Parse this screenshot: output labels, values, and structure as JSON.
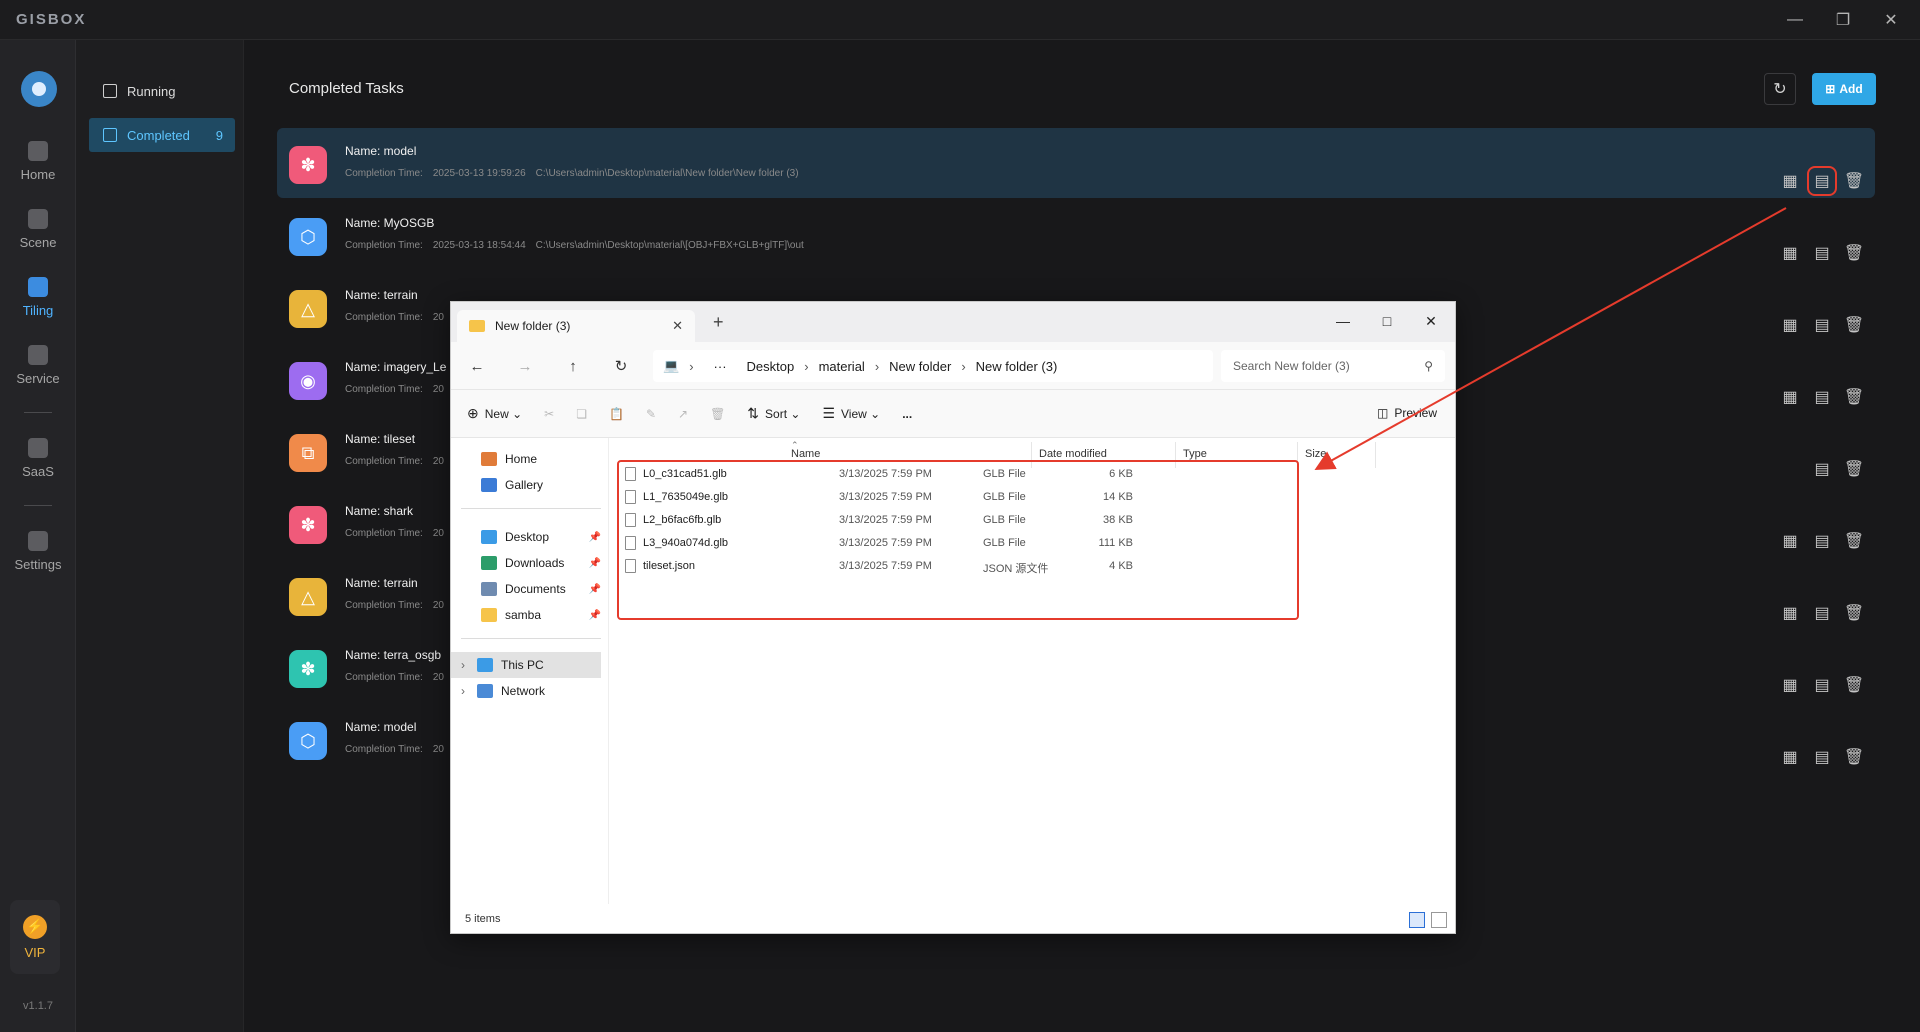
{
  "app": {
    "logo": "GISBOX",
    "version": "v1.1.7"
  },
  "nav": [
    {
      "label": "Home"
    },
    {
      "label": "Scene"
    },
    {
      "label": "Tiling"
    },
    {
      "label": "Service"
    },
    {
      "label": "SaaS"
    },
    {
      "label": "Settings"
    }
  ],
  "vip": {
    "label": "VIP"
  },
  "subnav": {
    "running": "Running",
    "completed": "Completed",
    "completed_count": "9"
  },
  "main": {
    "title": "Completed Tasks",
    "add_label": "Add"
  },
  "tasks": [
    {
      "name": "Name:  model",
      "time_label": "Completion Time:",
      "time": "2025-03-13 19:59:26",
      "path": "C:\\Users\\admin\\Desktop\\material\\New folder\\New folder (3)",
      "color": "#f05a7a"
    },
    {
      "name": "Name:  MyOSGB",
      "time_label": "Completion Time:",
      "time": "2025-03-13 18:54:44",
      "path": "C:\\Users\\admin\\Desktop\\material\\[OBJ+FBX+GLB+glTF]\\out",
      "color": "#4a9df5"
    },
    {
      "name": "Name:  terrain",
      "time_label": "Completion Time:",
      "time": "20",
      "path": "",
      "color": "#e8b43a"
    },
    {
      "name": "Name:  imagery_Le",
      "time_label": "Completion Time:",
      "time": "20",
      "path": "",
      "color": "#9d6cf0"
    },
    {
      "name": "Name:  tileset",
      "time_label": "Completion Time:",
      "time": "20",
      "path": "",
      "color": "#f08a4a"
    },
    {
      "name": "Name:  shark",
      "time_label": "Completion Time:",
      "time": "20",
      "path": "",
      "color": "#f05a7a"
    },
    {
      "name": "Name:  terrain",
      "time_label": "Completion Time:",
      "time": "20",
      "path": "",
      "color": "#e8b43a"
    },
    {
      "name": "Name:  terra_osgb",
      "time_label": "Completion Time:",
      "time": "20",
      "path": "",
      "color": "#2ec4b0"
    },
    {
      "name": "Name:  model",
      "time_label": "Completion Time:",
      "time": "20",
      "path": "",
      "color": "#4a9df5"
    }
  ],
  "explorer": {
    "tab_title": "New folder (3)",
    "path": [
      "Desktop",
      "material",
      "New folder",
      "New folder (3)"
    ],
    "search_placeholder": "Search New folder (3)",
    "cmd": {
      "new": "New",
      "sort": "Sort",
      "view": "View",
      "more": "...",
      "preview": "Preview"
    },
    "sidebar": [
      {
        "label": "Home"
      },
      {
        "label": "Gallery"
      },
      {
        "label": "Desktop"
      },
      {
        "label": "Downloads"
      },
      {
        "label": "Documents"
      },
      {
        "label": "samba"
      },
      {
        "label": "This PC"
      },
      {
        "label": "Network"
      }
    ],
    "columns": {
      "name": "Name",
      "date": "Date modified",
      "type": "Type",
      "size": "Size"
    },
    "files": [
      {
        "name": "L0_c31cad51.glb",
        "date": "3/13/2025 7:59 PM",
        "type": "GLB File",
        "size": "6 KB"
      },
      {
        "name": "L1_7635049e.glb",
        "date": "3/13/2025 7:59 PM",
        "type": "GLB File",
        "size": "14 KB"
      },
      {
        "name": "L2_b6fac6fb.glb",
        "date": "3/13/2025 7:59 PM",
        "type": "GLB File",
        "size": "38 KB"
      },
      {
        "name": "L3_940a074d.glb",
        "date": "3/13/2025 7:59 PM",
        "type": "GLB File",
        "size": "111 KB"
      },
      {
        "name": "tileset.json",
        "date": "3/13/2025 7:59 PM",
        "type": "JSON 源文件",
        "size": "4 KB"
      }
    ],
    "status": "5 items"
  },
  "colors": {
    "accent": "#2fa7e6",
    "highlight": "#e53b2c"
  }
}
